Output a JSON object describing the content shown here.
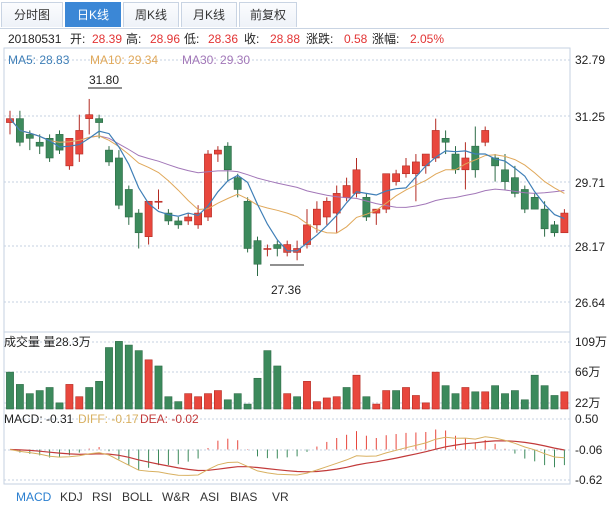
{
  "tabs": [
    {
      "label": "分时图",
      "active": false
    },
    {
      "label": "日K线",
      "active": true
    },
    {
      "label": "周K线",
      "active": false
    },
    {
      "label": "月K线",
      "active": false
    },
    {
      "label": "前复权",
      "active": false
    }
  ],
  "info": {
    "date": "20180531",
    "open_label": "开:",
    "open": "28.39",
    "high_label": "高:",
    "high": "28.96",
    "low_label": "低:",
    "low": "28.36",
    "close_label": "收:",
    "close": "28.88",
    "change_label": "涨跌:",
    "change": "0.58",
    "pct_label": "涨幅:",
    "pct": "2.05%"
  },
  "ma": {
    "ma5": "MA5: 28.83",
    "ma10": "MA10: 29.34",
    "ma30": "MA30: 29.30"
  },
  "volume_label": "成交量 量28.3万",
  "macd_label": {
    "macd": "MACD: -0.31",
    "diff": "DIFF: -0.17",
    "dea": "DEA: -0.02"
  },
  "annotations": {
    "high": "31.80",
    "low": "27.36"
  },
  "bottom_tabs": [
    "MACD",
    "KDJ",
    "RSI",
    "BOLL",
    "W&R",
    "ASI",
    "BIAS",
    "VR"
  ],
  "colors": {
    "up": "#e8473d",
    "down": "#3c8a5c",
    "ma5": "#3f7fb7",
    "ma10": "#e0a85a",
    "ma30": "#a277b8",
    "diff": "#d8b060",
    "dea": "#c23a3a",
    "label_up": "#e23434",
    "tab_active": "#3b87d6",
    "grid": "#c6d2e2"
  },
  "chart_data": [
    {
      "type": "candlestick",
      "y_ticks": [
        "32.79",
        "31.25",
        "29.71",
        "28.17",
        "26.64"
      ],
      "ylim": [
        26.64,
        32.79
      ],
      "ohlc": [
        [
          31.2,
          31.5,
          30.9,
          31.3
        ],
        [
          31.3,
          31.5,
          30.6,
          30.7
        ],
        [
          30.9,
          31.0,
          30.5,
          30.8
        ],
        [
          30.7,
          30.9,
          30.4,
          30.6
        ],
        [
          30.8,
          30.9,
          30.2,
          30.3
        ],
        [
          30.9,
          31.0,
          30.4,
          30.5
        ],
        [
          30.1,
          30.8,
          30.0,
          30.8
        ],
        [
          30.4,
          31.4,
          30.2,
          31.0
        ],
        [
          31.3,
          31.8,
          30.9,
          31.4
        ],
        [
          31.3,
          31.4,
          30.8,
          31.2
        ],
        [
          30.5,
          30.6,
          30.1,
          30.2
        ],
        [
          30.3,
          30.5,
          29.0,
          29.1
        ],
        [
          29.5,
          29.6,
          28.6,
          28.8
        ],
        [
          28.9,
          29.0,
          28.0,
          28.4
        ],
        [
          28.3,
          29.2,
          28.1,
          29.2
        ],
        [
          29.2,
          29.5,
          29.0,
          29.2
        ],
        [
          28.9,
          29.0,
          28.6,
          28.7
        ],
        [
          28.7,
          28.8,
          28.5,
          28.6
        ],
        [
          28.7,
          28.9,
          28.6,
          28.8
        ],
        [
          28.6,
          29.1,
          28.5,
          28.9
        ],
        [
          28.8,
          30.5,
          28.7,
          30.4
        ],
        [
          30.4,
          30.6,
          30.2,
          30.5
        ],
        [
          30.6,
          30.7,
          29.7,
          30.0
        ],
        [
          29.8,
          29.9,
          29.3,
          29.5
        ],
        [
          29.2,
          29.3,
          27.9,
          28.0
        ],
        [
          28.2,
          28.3,
          27.3,
          27.6
        ],
        [
          28.0,
          28.1,
          27.8,
          28.0
        ],
        [
          28.1,
          28.2,
          27.8,
          28.0
        ],
        [
          27.9,
          28.2,
          27.8,
          28.1
        ],
        [
          27.9,
          28.2,
          27.7,
          28.0
        ],
        [
          28.1,
          29.0,
          28.0,
          28.6
        ],
        [
          28.6,
          29.2,
          28.4,
          29.0
        ],
        [
          28.8,
          29.3,
          28.6,
          29.2
        ],
        [
          28.9,
          29.6,
          28.4,
          29.4
        ],
        [
          29.3,
          29.8,
          29.2,
          29.6
        ],
        [
          29.4,
          30.3,
          29.3,
          30.0
        ],
        [
          29.3,
          29.4,
          28.7,
          28.8
        ],
        [
          28.9,
          29.0,
          28.6,
          29.0
        ],
        [
          29.0,
          29.9,
          28.9,
          29.9
        ],
        [
          29.7,
          30.0,
          29.6,
          29.9
        ],
        [
          29.9,
          30.3,
          29.8,
          30.1
        ],
        [
          29.9,
          30.4,
          29.2,
          30.2
        ],
        [
          30.1,
          30.4,
          29.9,
          30.4
        ],
        [
          30.3,
          31.3,
          30.2,
          31.0
        ],
        [
          30.8,
          31.0,
          30.4,
          30.7
        ],
        [
          30.4,
          30.6,
          29.9,
          30.0
        ],
        [
          30.0,
          30.7,
          29.5,
          30.3
        ],
        [
          30.6,
          31.1,
          29.8,
          30.0
        ],
        [
          30.7,
          31.1,
          30.6,
          31.0
        ],
        [
          30.3,
          30.4,
          29.7,
          30.1
        ],
        [
          30.0,
          30.4,
          29.5,
          29.7
        ],
        [
          29.8,
          30.1,
          29.3,
          29.4
        ],
        [
          29.5,
          29.6,
          28.9,
          29.0
        ],
        [
          29.3,
          29.4,
          29.0,
          29.0
        ],
        [
          29.0,
          29.2,
          28.3,
          28.5
        ],
        [
          28.6,
          28.7,
          28.3,
          28.4
        ],
        [
          28.4,
          29.0,
          28.4,
          28.9
        ]
      ]
    },
    {
      "type": "bar",
      "name": "volume",
      "y_ticks": [
        "109万",
        "66万",
        "22万"
      ],
      "ylim": [
        0,
        109
      ],
      "values": [
        60,
        40,
        25,
        30,
        35,
        10,
        40,
        20,
        35,
        45,
        100,
        110,
        104,
        95,
        80,
        70,
        20,
        12,
        25,
        20,
        25,
        30,
        15,
        25,
        8,
        50,
        95,
        70,
        25,
        20,
        45,
        12,
        18,
        20,
        35,
        55,
        20,
        8,
        30,
        30,
        35,
        22,
        10,
        60,
        38,
        25,
        35,
        28,
        28,
        38,
        25,
        30,
        15,
        55,
        38,
        22,
        28
      ],
      "up": [
        false,
        false,
        false,
        false,
        false,
        false,
        true,
        true,
        false,
        false,
        false,
        false,
        false,
        false,
        true,
        false,
        false,
        false,
        true,
        true,
        true,
        true,
        false,
        false,
        false,
        false,
        false,
        false,
        true,
        false,
        true,
        true,
        true,
        true,
        false,
        true,
        false,
        true,
        true,
        false,
        true,
        true,
        true,
        true,
        false,
        false,
        true,
        false,
        true,
        false,
        false,
        false,
        false,
        false,
        false,
        false,
        true
      ]
    },
    {
      "type": "bar",
      "name": "macd",
      "y_ticks": [
        "0.50",
        "-0.06",
        "-0.62"
      ],
      "ylim": [
        -0.62,
        0.5
      ]
    }
  ]
}
